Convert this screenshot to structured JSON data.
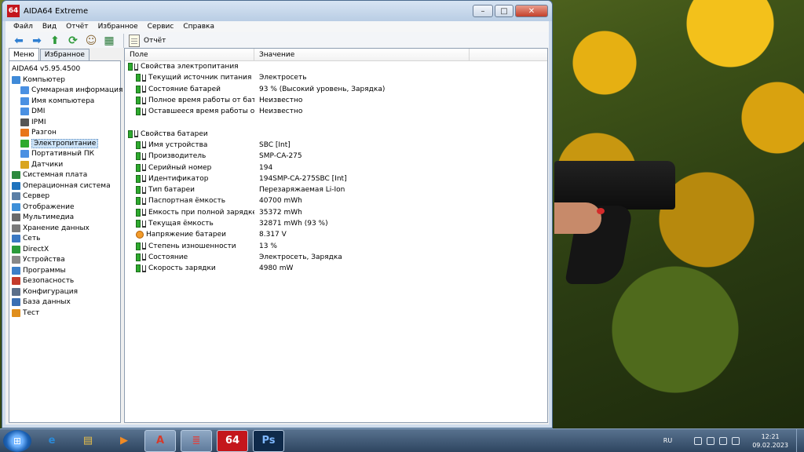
{
  "window": {
    "title": "AIDA64 Extreme",
    "app_icon_text": "64",
    "min_glyph": "–",
    "max_glyph": "□",
    "close_glyph": "✕"
  },
  "menu": [
    "Файл",
    "Вид",
    "Отчёт",
    "Избранное",
    "Сервис",
    "Справка"
  ],
  "toolbar": {
    "icons": [
      "back-arrow-icon",
      "forward-arrow-icon",
      "up-arrow-icon",
      "refresh-icon",
      "users-icon",
      "chart-icon"
    ],
    "report_label": "Отчёт"
  },
  "left": {
    "tabs": [
      "Меню",
      "Избранное"
    ],
    "active_tab": "Меню",
    "root_label": "AIDA64 v5.95.4500",
    "tree": [
      {
        "label": "Компьютер",
        "level": 0,
        "icon": "computer-icon",
        "color": "#3f8ad8"
      },
      {
        "label": "Суммарная информация",
        "level": 1,
        "icon": "monitor-icon",
        "color": "#4a90e2"
      },
      {
        "label": "Имя компьютера",
        "level": 1,
        "icon": "monitor-icon",
        "color": "#4a90e2"
      },
      {
        "label": "DMI",
        "level": 1,
        "icon": "monitor-icon",
        "color": "#4a90e2"
      },
      {
        "label": "IPMI",
        "level": 1,
        "icon": "device-icon",
        "color": "#555555"
      },
      {
        "label": "Разгон",
        "level": 1,
        "icon": "flame-icon",
        "color": "#e8761a"
      },
      {
        "label": "Электропитание",
        "level": 1,
        "icon": "battery-icon",
        "color": "#2eaa2e",
        "selected": true
      },
      {
        "label": "Портативный ПК",
        "level": 1,
        "icon": "laptop-icon",
        "color": "#4a90e2"
      },
      {
        "label": "Датчики",
        "level": 1,
        "icon": "sensor-icon",
        "color": "#d9a520"
      },
      {
        "label": "Системная плата",
        "level": 0,
        "icon": "motherboard-icon",
        "color": "#2d8a3e"
      },
      {
        "label": "Операционная система",
        "level": 0,
        "icon": "windows-icon",
        "color": "#1e73be"
      },
      {
        "label": "Сервер",
        "level": 0,
        "icon": "server-icon",
        "color": "#5b7fa6"
      },
      {
        "label": "Отображение",
        "level": 0,
        "icon": "display-icon",
        "color": "#3d8fd8"
      },
      {
        "label": "Мультимедиа",
        "level": 0,
        "icon": "multimedia-icon",
        "color": "#6a6a6a"
      },
      {
        "label": "Хранение данных",
        "level": 0,
        "icon": "storage-icon",
        "color": "#7a7a7a"
      },
      {
        "label": "Сеть",
        "level": 0,
        "icon": "network-icon",
        "color": "#3a78c2"
      },
      {
        "label": "DirectX",
        "level": 0,
        "icon": "directx-icon",
        "color": "#2b9b3a"
      },
      {
        "label": "Устройства",
        "level": 0,
        "icon": "devices-icon",
        "color": "#888888"
      },
      {
        "label": "Программы",
        "level": 0,
        "icon": "programs-icon",
        "color": "#3c7fc8"
      },
      {
        "label": "Безопасность",
        "level": 0,
        "icon": "security-icon",
        "color": "#c43b2b"
      },
      {
        "label": "Конфигурация",
        "level": 0,
        "icon": "config-icon",
        "color": "#5b6f8a"
      },
      {
        "label": "База данных",
        "level": 0,
        "icon": "database-icon",
        "color": "#3a6fb3"
      },
      {
        "label": "Тест",
        "level": 0,
        "icon": "test-icon",
        "color": "#e08e1c"
      }
    ]
  },
  "right": {
    "columns": [
      "Поле",
      "Значение"
    ],
    "groups": [
      {
        "title": "Свойства электропитания",
        "rows": [
          {
            "field": "Текущий источник питания",
            "value": "Электросеть",
            "icon": "battery"
          },
          {
            "field": "Состояние батарей",
            "value": "93 % (Высокий уровень, Зарядка)",
            "icon": "battery"
          },
          {
            "field": "Полное время работы от бата...",
            "value": "Неизвестно",
            "icon": "battery"
          },
          {
            "field": "Оставшееся время работы от ...",
            "value": "Неизвестно",
            "icon": "battery"
          }
        ]
      },
      {
        "title": "Свойства батареи",
        "rows": [
          {
            "field": "Имя устройства",
            "value": "SBC [Int]",
            "icon": "battery"
          },
          {
            "field": "Производитель",
            "value": "SMP-CA-275",
            "icon": "battery"
          },
          {
            "field": "Серийный номер",
            "value": "194",
            "icon": "battery"
          },
          {
            "field": "Идентификатор",
            "value": "194SMP-CA-275SBC [Int]",
            "icon": "battery"
          },
          {
            "field": "Тип батареи",
            "value": "Перезаряжаемая Li-Ion",
            "icon": "battery"
          },
          {
            "field": "Паспортная ёмкость",
            "value": "40700 mWh",
            "icon": "battery"
          },
          {
            "field": "Ёмкость при полной зарядке",
            "value": "35372 mWh",
            "icon": "battery"
          },
          {
            "field": "Текущая ёмкость",
            "value": "32871 mWh  (93 %)",
            "icon": "battery"
          },
          {
            "field": "Напряжение батареи",
            "value": "8.317 V",
            "icon": "voltage"
          },
          {
            "field": "Степень изношенности",
            "value": "13 %",
            "icon": "battery"
          },
          {
            "field": "Состояние",
            "value": "Электросеть, Зарядка",
            "icon": "battery"
          },
          {
            "field": "Скорость зарядки",
            "value": "4980 mW",
            "icon": "battery"
          }
        ]
      }
    ]
  },
  "taskbar": {
    "apps": [
      {
        "name": "ie-icon",
        "glyph": "e",
        "color": "#2b8ad8",
        "active": false
      },
      {
        "name": "explorer-icon",
        "glyph": "▤",
        "color": "#e8c04a",
        "active": false
      },
      {
        "name": "media-player-icon",
        "glyph": "▶",
        "color": "#f08a24",
        "active": false
      },
      {
        "name": "app-red-icon",
        "glyph": "A",
        "color": "#d63a2a",
        "active": true
      },
      {
        "name": "notepad-icon",
        "glyph": "≣",
        "color": "#d34a4a",
        "active": true
      },
      {
        "name": "aida64-icon",
        "glyph": "64",
        "color": "#ffffff",
        "active": true
      },
      {
        "name": "photoshop-icon",
        "glyph": "Ps",
        "color": "#7fb8ff",
        "active": true
      }
    ],
    "lang": "RU",
    "time": "12:21",
    "date": "09.02.2023"
  }
}
